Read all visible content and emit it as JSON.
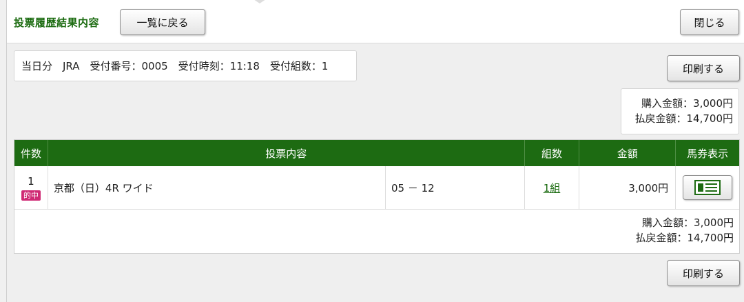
{
  "header": {
    "title": "投票履歴結果内容",
    "back_label": "一覧に戻る",
    "close_label": "閉じる"
  },
  "info": {
    "text": "当日分　JRA　受付番号：0005　受付時刻：11:18　受付組数：1"
  },
  "print_label": "印刷する",
  "summary": {
    "purchase": "購入金額：3,000円",
    "payout": "払戻金額：14,700円"
  },
  "table": {
    "headers": {
      "count": "件数",
      "content": "投票内容",
      "kumi": "組数",
      "amount": "金額",
      "ticket": "馬券表示"
    },
    "rows": [
      {
        "num": "1",
        "badge": "的中",
        "race": "京都（日）4R ワイド",
        "combo": "05 － 12",
        "kumi": "1組",
        "amount": "3,000円"
      }
    ],
    "footer": {
      "purchase": "購入金額：3,000円",
      "payout": "払戻金額：14,700円"
    }
  },
  "colors": {
    "accent": "#1d6b12",
    "title": "#1b6b10",
    "badge": "#cf2a74"
  }
}
